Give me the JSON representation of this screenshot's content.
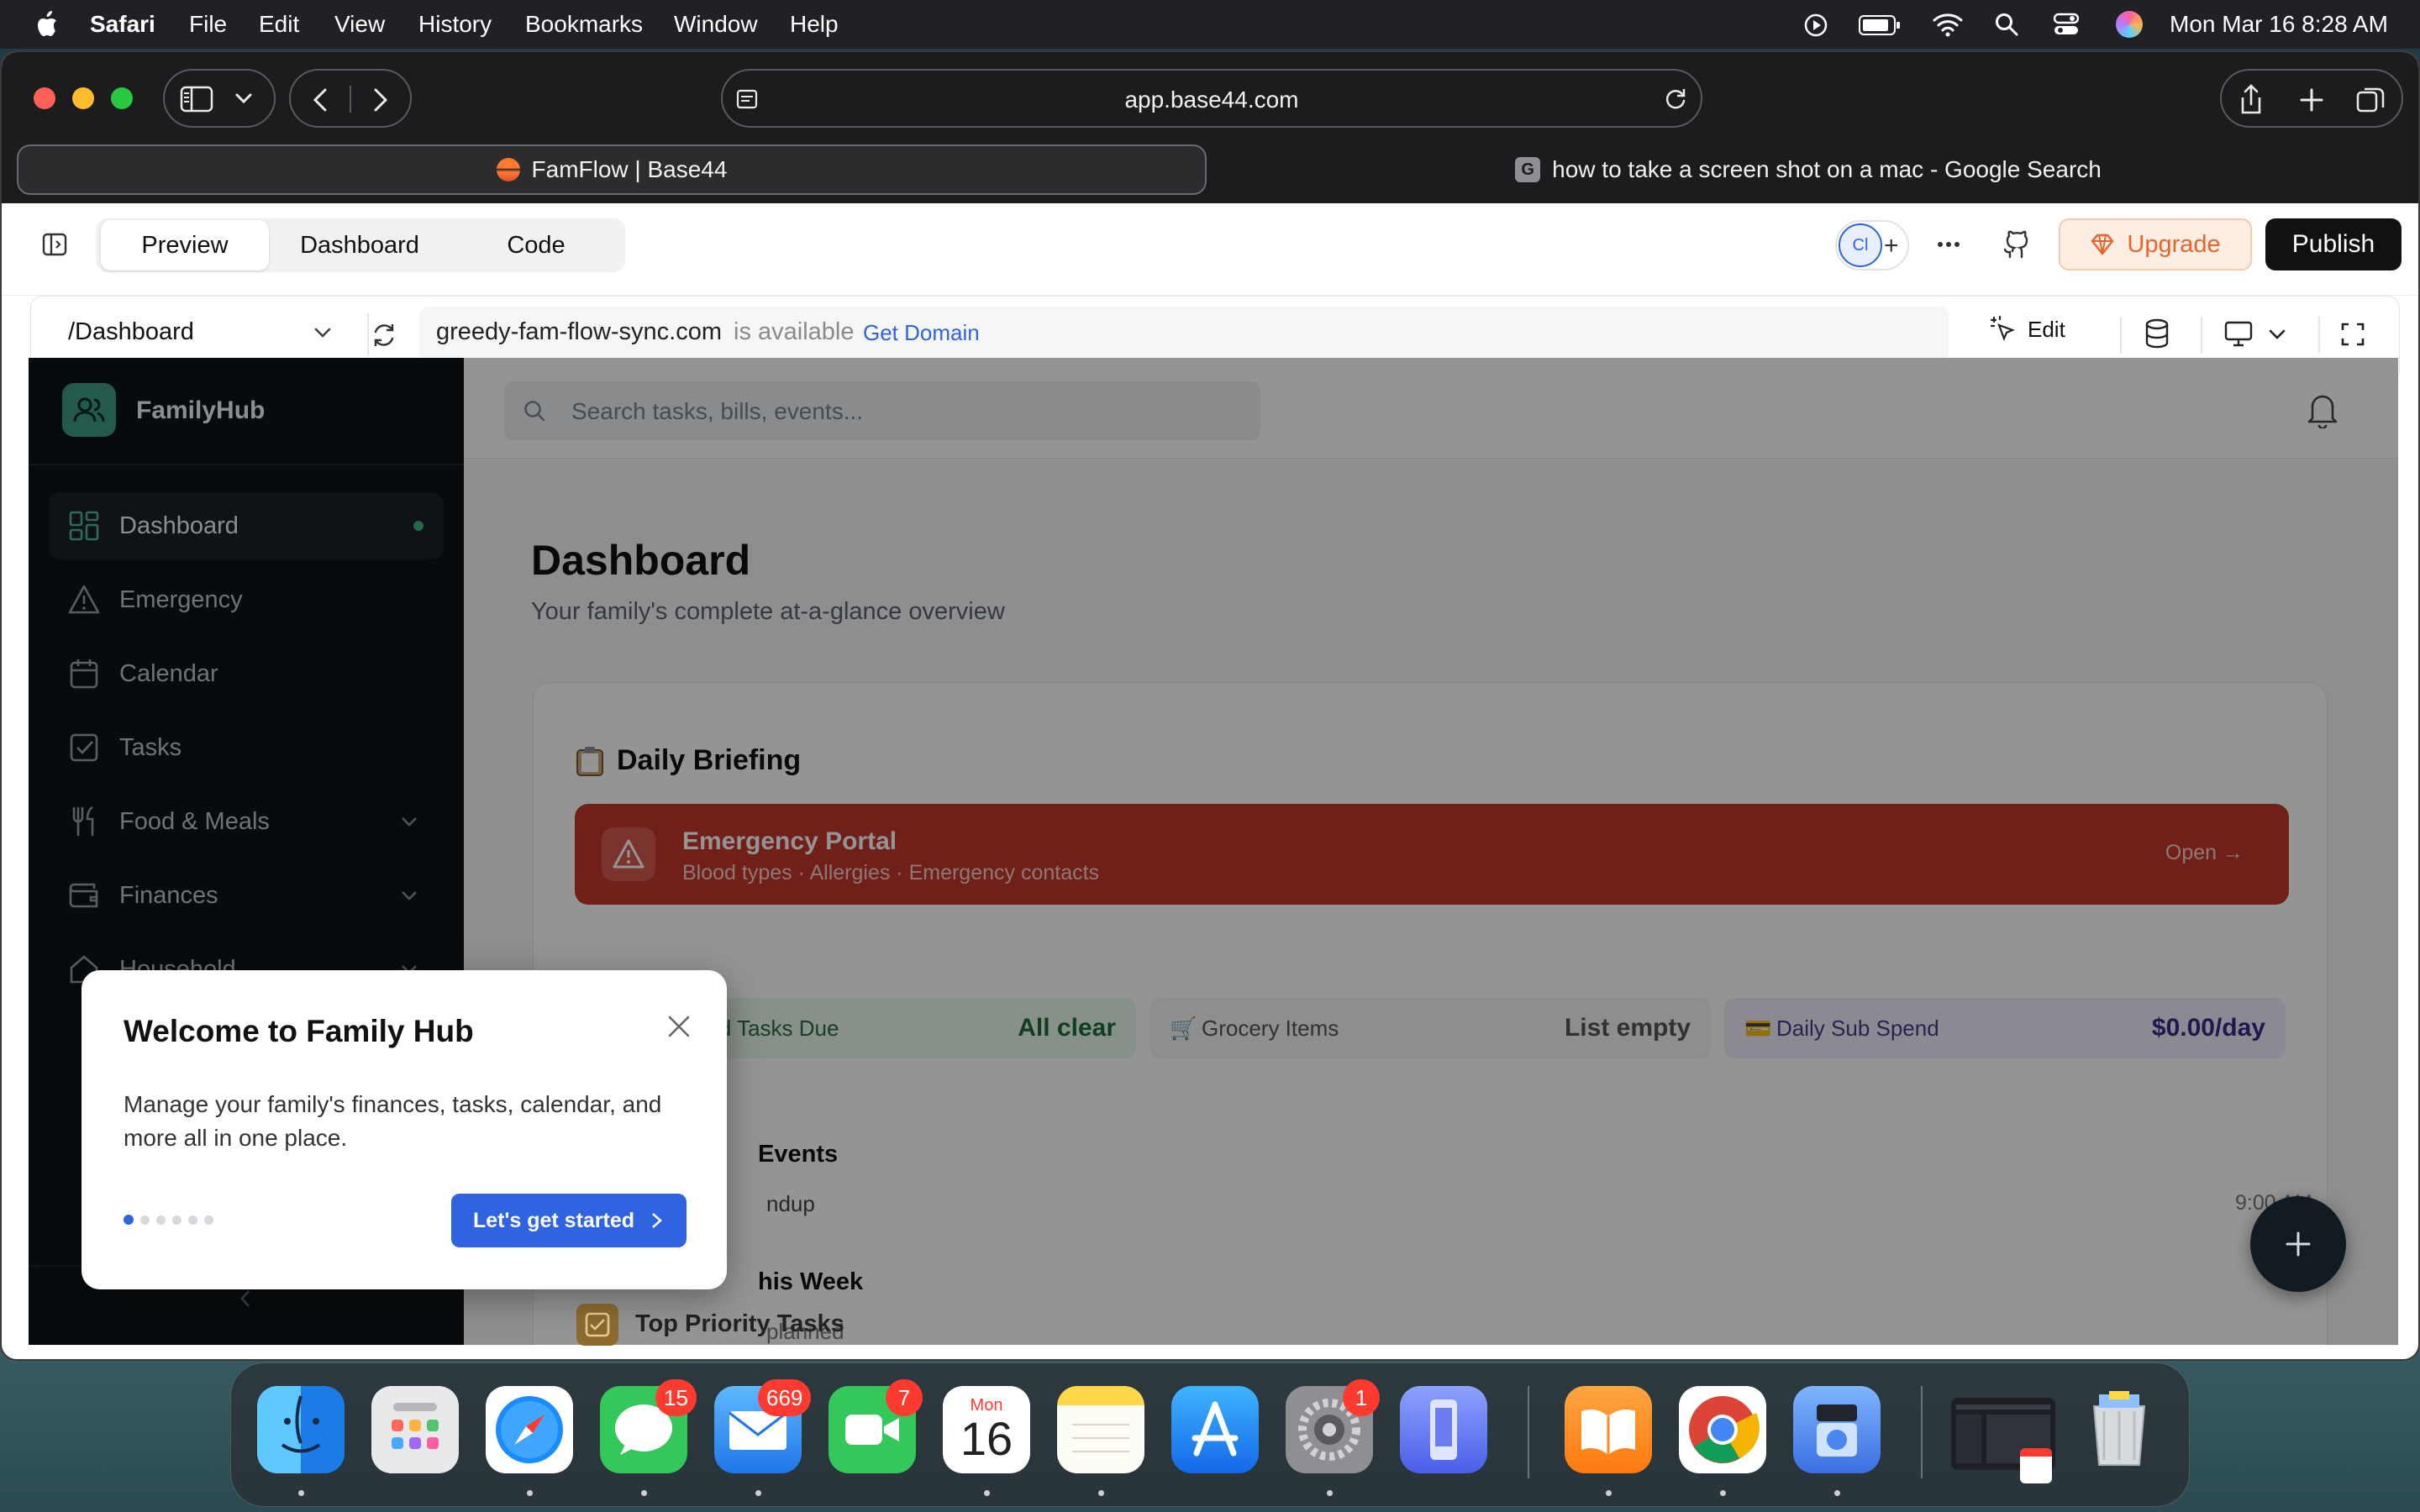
{
  "menubar": {
    "app": "Safari",
    "items": [
      "File",
      "Edit",
      "View",
      "History",
      "Bookmarks",
      "Window",
      "Help"
    ],
    "datetime": "Mon Mar 16  8:28 AM"
  },
  "browser": {
    "url": "app.base44.com",
    "tabs": [
      {
        "title": "FamFlow | Base44",
        "active": true
      },
      {
        "title": "how to take a screen shot on a mac - Google Search",
        "active": false
      }
    ]
  },
  "builder": {
    "modes": [
      "Preview",
      "Dashboard",
      "Code"
    ],
    "active_mode": "Preview",
    "avatar_initials": "Cl",
    "upgrade_label": "Upgrade",
    "publish_label": "Publish",
    "route": "/Dashboard",
    "domain_name": "greedy-fam-flow-sync.com",
    "domain_status": "is available",
    "get_domain_label": "Get Domain",
    "edit_label": "Edit"
  },
  "app": {
    "brand": "FamilyHub",
    "search_placeholder": "Search tasks, bills, events...",
    "nav": [
      {
        "label": "Dashboard",
        "active": true
      },
      {
        "label": "Emergency"
      },
      {
        "label": "Calendar"
      },
      {
        "label": "Tasks"
      },
      {
        "label": "Food & Meals",
        "has_children": true
      },
      {
        "label": "Finances",
        "has_children": true
      },
      {
        "label": "Household",
        "has_children": true
      }
    ],
    "page_title": "Dashboard",
    "page_subtitle": "Your family's complete at-a-glance overview",
    "briefing_title": "Daily Briefing",
    "emergency": {
      "title": "Emergency Portal",
      "subtitle": "Blood types · Allergies · Emergency contacts",
      "action": "Open →"
    },
    "stats": [
      {
        "label": "Household Tasks Due",
        "value": "All clear"
      },
      {
        "label": "Grocery Items",
        "value": "List empty"
      },
      {
        "label": "Daily Sub Spend",
        "value": "$0.00/day"
      }
    ],
    "events_heading": "Events",
    "event_name": "ndup",
    "event_time": "9:00 AM",
    "week_heading": "his Week",
    "week_text": "planned",
    "priority_heading": "Top Priority Tasks"
  },
  "modal": {
    "title": "Welcome to Family Hub",
    "body": "Manage your family's finances, tasks, calendar, and more all in one place.",
    "cta": "Let's get started",
    "steps_total": 6,
    "step_current": 1
  },
  "dock": {
    "badges": {
      "messages": "15",
      "mail": "669",
      "facetime": "7",
      "settings": "1"
    },
    "calendar_month": "Mon",
    "calendar_day": "16"
  },
  "colors": {
    "accent_blue": "#2f63e0",
    "emergency_red": "#c0392b",
    "sidebar_bg": "#0f1318",
    "brand_green": "#3f9b84"
  }
}
